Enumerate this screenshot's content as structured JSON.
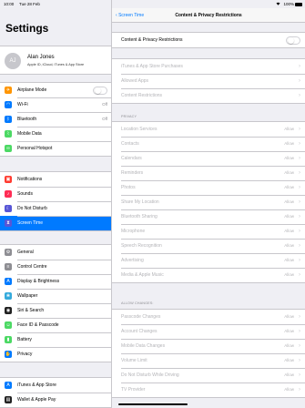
{
  "status": {
    "time": "10:00",
    "date": "Tue 28 Feb",
    "battery": "100%"
  },
  "left": {
    "title": "Settings",
    "profile": {
      "initials": "AJ",
      "name": "Alan Jones",
      "subtitle": "Apple ID, iCloud, iTunes & App Store"
    },
    "groups": [
      {
        "items": [
          {
            "label": "Airplane Mode",
            "icon": "airplane-icon",
            "color": "#ff9500",
            "toggle": true
          },
          {
            "label": "Wi-Fi",
            "value": "Off",
            "icon": "wifi-icon",
            "color": "#007aff"
          },
          {
            "label": "Bluetooth",
            "value": "Off",
            "icon": "bluetooth-icon",
            "color": "#007aff"
          },
          {
            "label": "Mobile Data",
            "icon": "antenna-icon",
            "color": "#4cd964"
          },
          {
            "label": "Personal Hotspot",
            "icon": "hotspot-icon",
            "color": "#4cd964"
          }
        ]
      },
      {
        "items": [
          {
            "label": "Notifications",
            "icon": "notifications-icon",
            "color": "#ff3b30"
          },
          {
            "label": "Sounds",
            "icon": "speaker-icon",
            "color": "#ff2d55"
          },
          {
            "label": "Do Not Disturb",
            "icon": "moon-icon",
            "color": "#5856d6"
          },
          {
            "label": "Screen Time",
            "icon": "hourglass-icon",
            "color": "#5856d6",
            "selected": true
          }
        ]
      },
      {
        "items": [
          {
            "label": "General",
            "icon": "gear-icon",
            "color": "#8e8e93"
          },
          {
            "label": "Control Centre",
            "icon": "control-centre-icon",
            "color": "#8e8e93"
          },
          {
            "label": "Display & Brightness",
            "icon": "brightness-icon",
            "color": "#007aff"
          },
          {
            "label": "Wallpaper",
            "icon": "wallpaper-icon",
            "color": "#34aadc"
          },
          {
            "label": "Siri & Search",
            "icon": "siri-icon",
            "color": "#222222"
          },
          {
            "label": "Face ID & Passcode",
            "icon": "face-id-icon",
            "color": "#4cd964"
          },
          {
            "label": "Battery",
            "icon": "battery-icon",
            "color": "#4cd964"
          },
          {
            "label": "Privacy",
            "icon": "hand-icon",
            "color": "#007aff"
          }
        ]
      },
      {
        "items": [
          {
            "label": "iTunes & App Store",
            "icon": "app-store-icon",
            "color": "#007aff"
          },
          {
            "label": "Wallet & Apple Pay",
            "icon": "wallet-icon",
            "color": "#222222"
          }
        ]
      }
    ]
  },
  "right": {
    "back_label": "Screen Time",
    "title": "Content & Privacy Restrictions",
    "toggle_row": {
      "label": "Content & Privacy Restrictions"
    },
    "store_rows": [
      {
        "label": "iTunes & App Store Purchases"
      },
      {
        "label": "Allowed Apps"
      },
      {
        "label": "Content Restrictions"
      }
    ],
    "privacy_header": "PRIVACY",
    "privacy_rows": [
      {
        "label": "Location Services",
        "value": "Allow"
      },
      {
        "label": "Contacts",
        "value": "Allow"
      },
      {
        "label": "Calendars",
        "value": "Allow"
      },
      {
        "label": "Reminders",
        "value": "Allow"
      },
      {
        "label": "Photos",
        "value": "Allow"
      },
      {
        "label": "Share My Location",
        "value": "Allow"
      },
      {
        "label": "Bluetooth Sharing",
        "value": "Allow"
      },
      {
        "label": "Microphone",
        "value": "Allow"
      },
      {
        "label": "Speech Recognition",
        "value": "Allow"
      },
      {
        "label": "Advertising",
        "value": "Allow"
      },
      {
        "label": "Media & Apple Music",
        "value": "Allow"
      }
    ],
    "changes_header": "ALLOW CHANGES:",
    "changes_rows": [
      {
        "label": "Passcode Changes",
        "value": "Allow"
      },
      {
        "label": "Account Changes",
        "value": "Allow"
      },
      {
        "label": "Mobile Data Changes",
        "value": "Allow"
      },
      {
        "label": "Volume Limit",
        "value": "Allow"
      },
      {
        "label": "Do Not Disturb While Driving",
        "value": "Allow"
      },
      {
        "label": "TV Provider",
        "value": "Allow"
      }
    ]
  }
}
